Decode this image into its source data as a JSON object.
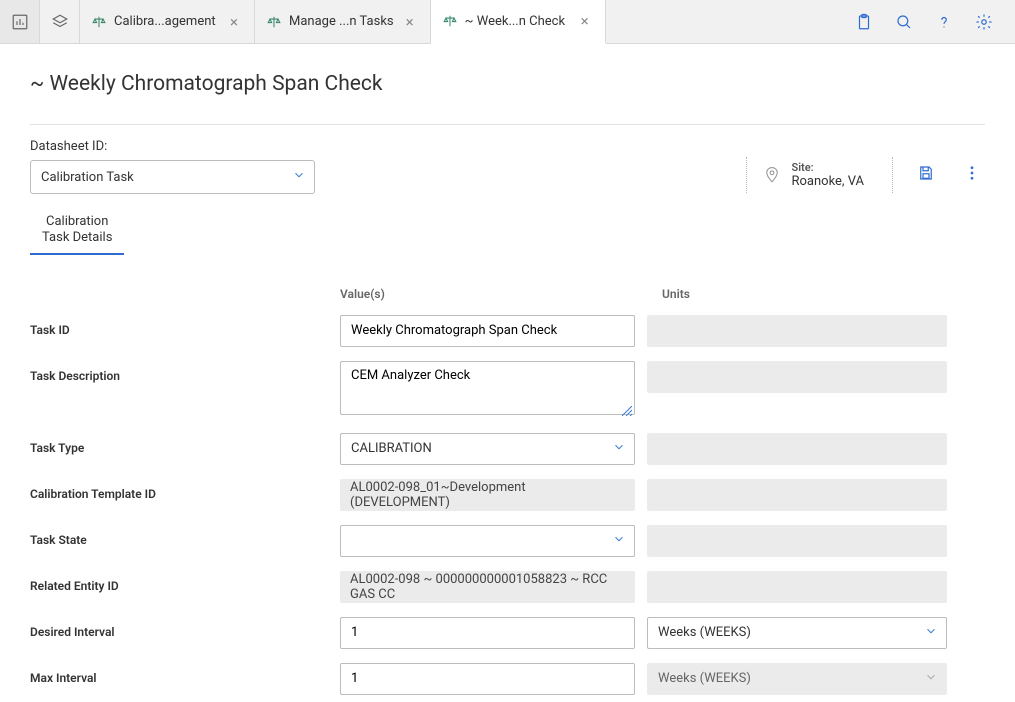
{
  "topbar": {
    "tabs": [
      {
        "label": "Calibra...agement"
      },
      {
        "label": "Manage ...n Tasks"
      },
      {
        "label": "~ Week...n Check"
      }
    ]
  },
  "page": {
    "title": "~ Weekly Chromatograph Span Check"
  },
  "datasheet": {
    "label": "Datasheet ID:",
    "value": "Calibration Task"
  },
  "site": {
    "label": "Site:",
    "value": "Roanoke, VA"
  },
  "subtab": {
    "label": "Calibration\nTask Details"
  },
  "columns": {
    "values": "Value(s)",
    "units": "Units"
  },
  "fields": {
    "task_id": {
      "label": "Task ID",
      "value": "Weekly Chromatograph Span Check"
    },
    "task_desc": {
      "label": "Task Description",
      "value": "CEM Analyzer Check"
    },
    "task_type": {
      "label": "Task Type",
      "value": "CALIBRATION"
    },
    "cal_template": {
      "label": "Calibration Template ID",
      "value": "AL0002-098_01~Development (DEVELOPMENT)"
    },
    "task_state": {
      "label": "Task State",
      "value": ""
    },
    "related_entity": {
      "label": "Related Entity ID",
      "value": "AL0002-098 ~ 000000000001058823 ~ RCC GAS CC"
    },
    "desired_interval": {
      "label": "Desired Interval",
      "value": "1",
      "units": "Weeks (WEEKS)"
    },
    "max_interval": {
      "label": "Max Interval",
      "value": "1",
      "units": "Weeks (WEEKS)"
    }
  }
}
